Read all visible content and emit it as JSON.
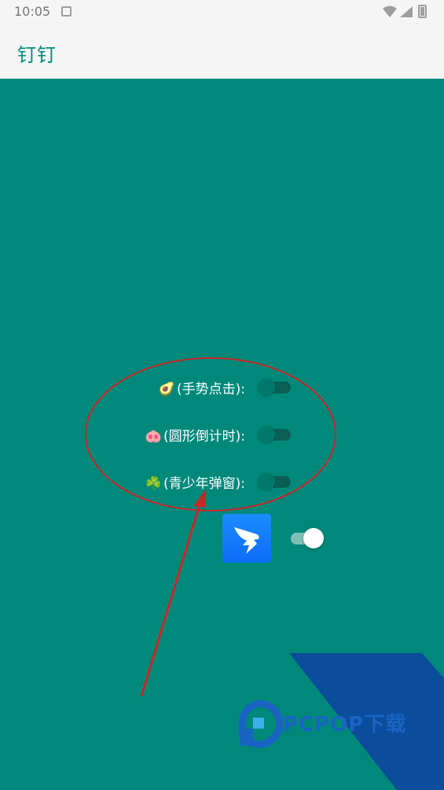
{
  "status_bar": {
    "time": "10:05",
    "icons": [
      "notification-icon",
      "wifi-icon",
      "signal-icon",
      "battery-icon"
    ]
  },
  "app_bar": {
    "title": "钉钉"
  },
  "options": [
    {
      "emoji": "🥑",
      "label": "(手势点击):",
      "enabled": false
    },
    {
      "emoji": "🐽",
      "label": "(圆形倒计时):",
      "enabled": false
    },
    {
      "emoji": "☘️",
      "label": "(青少年弹窗):",
      "enabled": false
    }
  ],
  "main_toggle": {
    "enabled": true,
    "app_icon": "dingtalk-app-icon"
  },
  "watermark": {
    "text": "PCPOP下载"
  },
  "colors": {
    "background": "#00897b",
    "app_bar": "#f5f5f5",
    "title": "#00897b",
    "annotation": "#c62828",
    "app_icon": "#1677ff"
  }
}
